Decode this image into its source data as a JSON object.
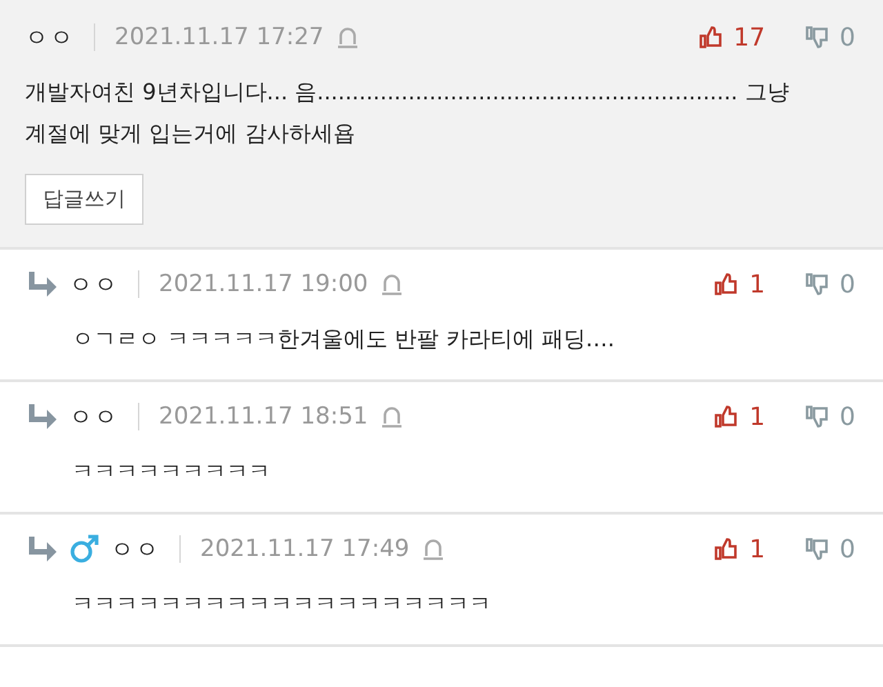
{
  "comments": [
    {
      "kind": "comment",
      "reply": false,
      "male": false,
      "author": "ㅇㅇ",
      "date": "2021.11.17 17:27",
      "likes": "17",
      "dislikes": "0",
      "text": "개발자여친 9년차입니다... 음............................................................ 그냥 계절에 맞게 입는거에 감사하세욥",
      "reply_button": "답글쓰기"
    },
    {
      "kind": "comment",
      "reply": true,
      "male": false,
      "author": "ㅇㅇ",
      "date": "2021.11.17 19:00",
      "likes": "1",
      "dislikes": "0",
      "text": "ㅇㄱㄹㅇ ㅋㅋㅋㅋㅋ한겨울에도 반팔 카라티에 패딩…."
    },
    {
      "kind": "comment",
      "reply": true,
      "male": false,
      "author": "ㅇㅇ",
      "date": "2021.11.17 18:51",
      "likes": "1",
      "dislikes": "0",
      "text": "ㅋㅋㅋㅋㅋㅋㅋㅋㅋ"
    },
    {
      "kind": "comment",
      "reply": true,
      "male": true,
      "author": "ㅇㅇ",
      "date": "2021.11.17 17:49",
      "likes": "1",
      "dislikes": "0",
      "text": "ㅋㅋㅋㅋㅋㅋㅋㅋㅋㅋㅋㅋㅋㅋㅋㅋㅋㅋㅋ"
    }
  ]
}
